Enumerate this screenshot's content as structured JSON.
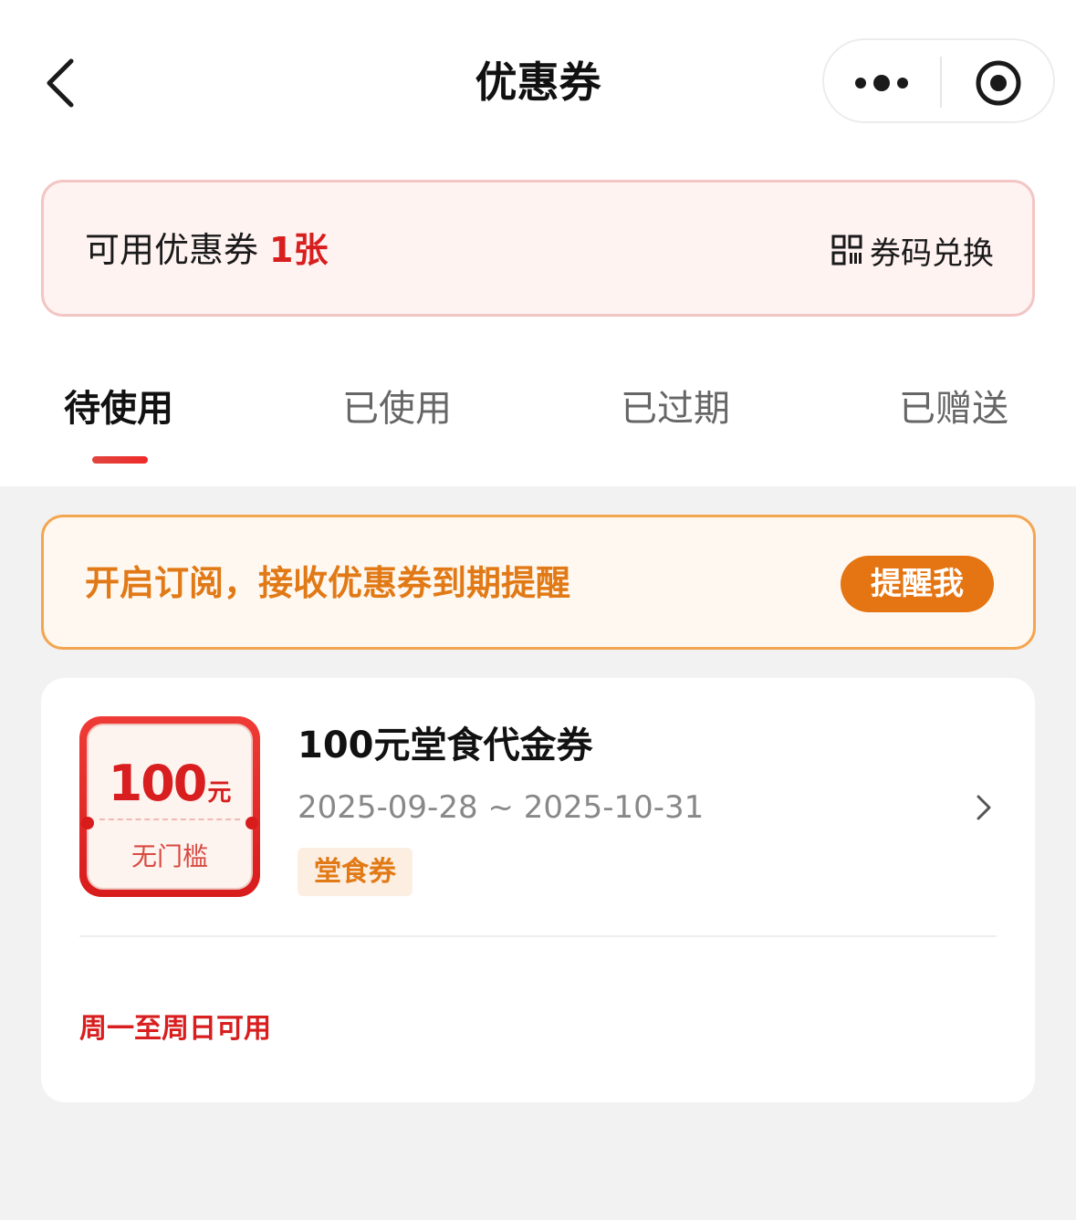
{
  "nav": {
    "title": "优惠券"
  },
  "summary": {
    "label": "可用优惠券",
    "count": "1张",
    "redeem_label": "券码兑换"
  },
  "tabs": [
    {
      "label": "待使用",
      "active": true
    },
    {
      "label": "已使用",
      "active": false
    },
    {
      "label": "已过期",
      "active": false
    },
    {
      "label": "已赠送",
      "active": false
    }
  ],
  "subscribe": {
    "text": "开启订阅，接收优惠券到期提醒",
    "button_label": "提醒我"
  },
  "coupons": [
    {
      "amount": "100",
      "unit": "元",
      "condition": "无门槛",
      "title": "100元堂食代金券",
      "valid_dates": "2025-09-28 ~ 2025-10-31",
      "tag": "堂食券",
      "availability": "周一至周日可用"
    }
  ],
  "icons": {
    "back": "chevron-left-icon",
    "more": "more-dots-icon",
    "close": "target-circle-icon",
    "qr": "qr-code-icon",
    "arrow": "chevron-right-icon"
  },
  "colors": {
    "accent_red": "#d81e1e",
    "accent_orange": "#e57412",
    "page_bg": "#f2f2f2"
  }
}
